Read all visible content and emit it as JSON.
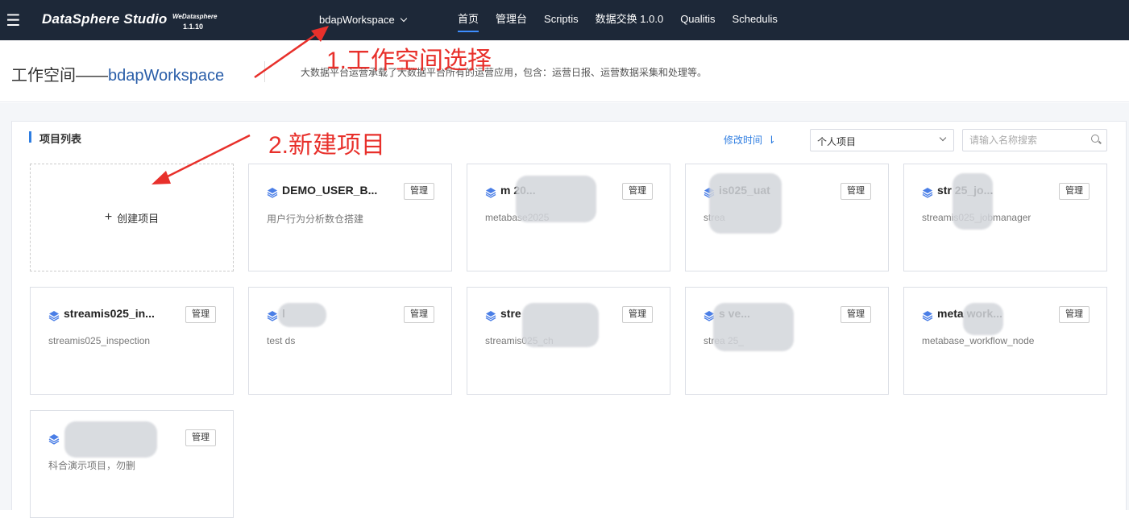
{
  "topbar": {
    "menu_icon": "hamburger-icon",
    "logo_text": "DataSphere Studio",
    "logo_sup": "WeDatasphere",
    "logo_version": "1.1.10",
    "workspace": "bdapWorkspace",
    "nav": [
      "首页",
      "管理台",
      "Scriptis",
      "数据交换 1.0.0",
      "Qualitis",
      "Schedulis"
    ]
  },
  "header": {
    "title_prefix": "工作空间——",
    "title_name": "bdapWorkspace",
    "description": "大数据平台运营承载了大数据平台所有的运营应用，包含：运营日报、运营数据采集和处理等。"
  },
  "list": {
    "title": "项目列表",
    "sort_label": "修改时间",
    "filter_value": "个人项目",
    "search_placeholder": "请输入名称搜索",
    "create_label": "创建项目",
    "manage_label": "管理"
  },
  "projects": [
    {
      "name": "DEMO_USER_B...",
      "desc": "用户行为分析数仓搭建"
    },
    {
      "name": "m          20...",
      "desc": "metabase2025"
    },
    {
      "name": "          is025_uat",
      "desc": "strea"
    },
    {
      "name": "str          25_jo...",
      "desc": "streamis025_jobmanager"
    },
    {
      "name": "streamis025_in...",
      "desc": "streamis025_inspection"
    },
    {
      "name": "l",
      "desc": "test ds"
    },
    {
      "name": "stre",
      "desc": "streamis025_ch"
    },
    {
      "name": "s          ve...",
      "desc": "strea        25_"
    },
    {
      "name": "meta          work...",
      "desc": "metabase_workflow_node"
    },
    {
      "name": "",
      "desc": "科合演示项目，勿删"
    }
  ],
  "annotations": {
    "step1": "1.工作空间选择",
    "step2": "2.新建项目"
  },
  "colors": {
    "topbar": "#1d2838",
    "accent": "#2e7de1",
    "annotation": "#e8302b"
  }
}
